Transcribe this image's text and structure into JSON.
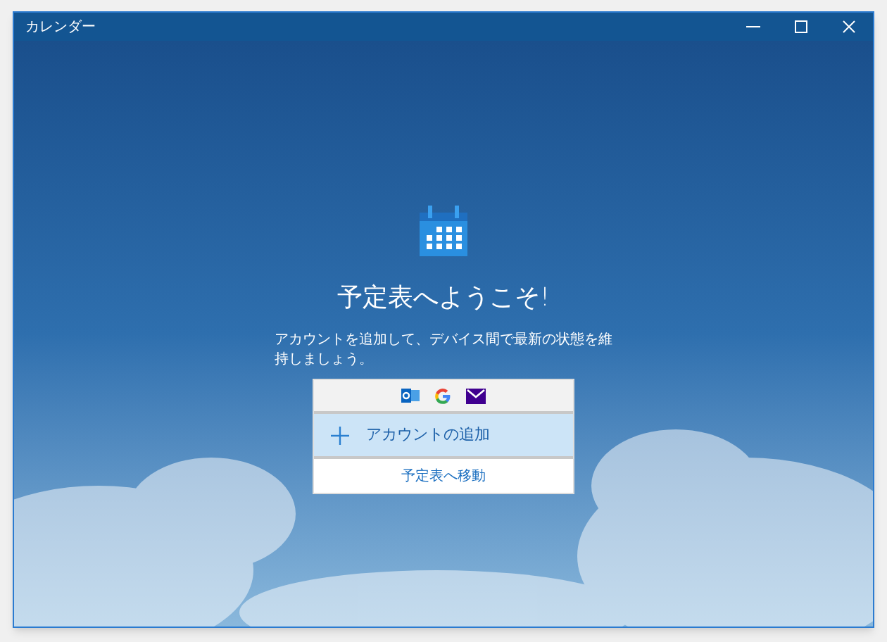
{
  "window": {
    "title": "カレンダー"
  },
  "welcome": {
    "title": "予定表へようこそ!",
    "description": "アカウントを追加して、デバイス間で最新の状態を維持しましょう。"
  },
  "add_account": {
    "label": "アカウントの追加"
  },
  "go_to_calendar": {
    "label": "予定表へ移動"
  }
}
